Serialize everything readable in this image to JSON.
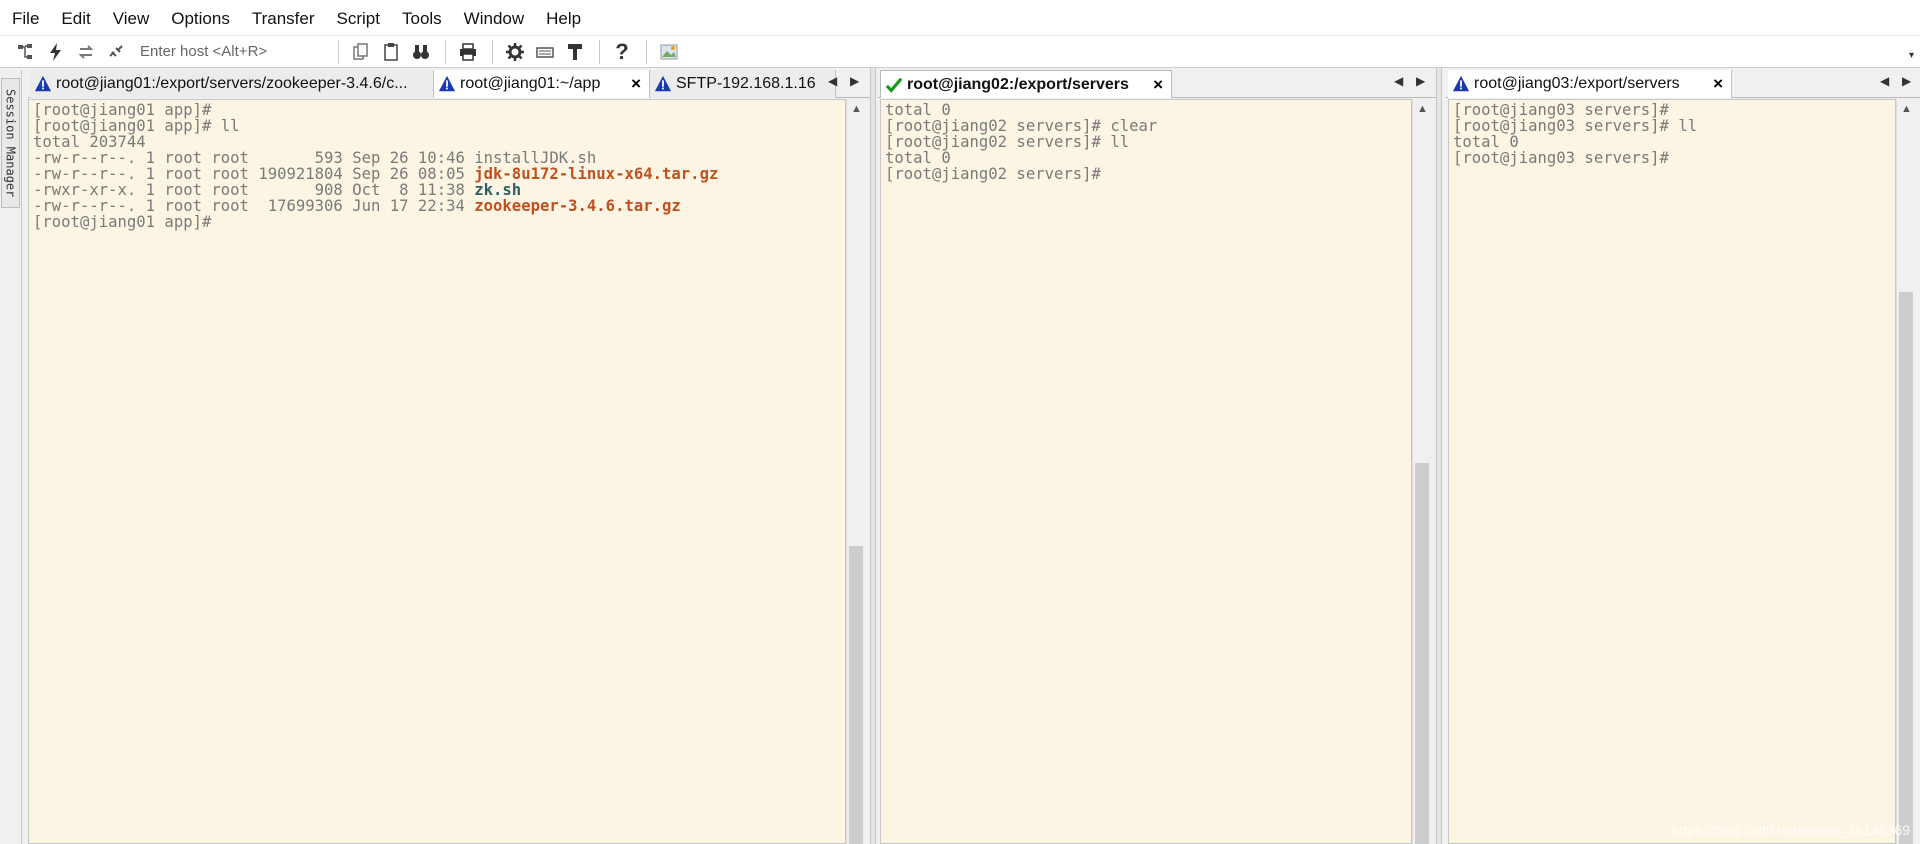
{
  "menu": [
    "File",
    "Edit",
    "View",
    "Options",
    "Transfer",
    "Script",
    "Tools",
    "Window",
    "Help"
  ],
  "toolbar": {
    "host_placeholder": "Enter host <Alt+R>"
  },
  "sidebar": {
    "session_manager_label": "Session Manager"
  },
  "pane1": {
    "tabs": [
      {
        "label": "root@jiang01:/export/servers/zookeeper-3.4.6/c...",
        "status": "warning"
      },
      {
        "label": "root@jiang01:~/app",
        "status": "warning",
        "close": "×"
      },
      {
        "label": "SFTP-192.168.1.16",
        "status": "warning"
      }
    ],
    "lines": [
      "[root@jiang01 app]#",
      "[root@jiang01 app]# ll",
      "total 203744"
    ],
    "files": [
      {
        "prefix": "-rw-r--r--. 1 root root       593 Sep 26 10:46 ",
        "name": "installJDK.sh",
        "style": "plain"
      },
      {
        "prefix": "-rw-r--r--. 1 root root 190921804 Sep 26 08:05 ",
        "name": "jdk-8u172-linux-x64.tar.gz",
        "style": "red"
      },
      {
        "prefix": "-rwxr-xr-x. 1 root root       908 Oct  8 11:38 ",
        "name": "zk.sh",
        "style": "teal"
      },
      {
        "prefix": "-rw-r--r--. 1 root root  17699306 Jun 17 22:34 ",
        "name": "zookeeper-3.4.6.tar.gz",
        "style": "red"
      }
    ],
    "last_line": "[root@jiang01 app]#"
  },
  "pane2": {
    "tab": {
      "label": "root@jiang02:/export/servers",
      "status": "ok",
      "close": "×"
    },
    "lines": [
      "total 0",
      "[root@jiang02 servers]# clear",
      "[root@jiang02 servers]# ll",
      "total 0",
      "[root@jiang02 servers]#"
    ]
  },
  "pane3": {
    "tab": {
      "label": "root@jiang03:/export/servers",
      "status": "warning",
      "close": "×"
    },
    "lines": [
      "[root@jiang03 servers]#",
      "[root@jiang03 servers]# ll",
      "total 0",
      "[root@jiang03 servers]#"
    ]
  },
  "watermark": "https://blog.csdn.net/weixin_36146369",
  "colors": {
    "terminal_bg": "#fcf5e3",
    "terminal_text": "#7a7a7a",
    "archive": "#c0501f",
    "executable": "#2e5f66"
  },
  "icons": [
    "session-tree-icon",
    "quick-connect-icon",
    "reconnect-icon",
    "disconnect-icon",
    "copy-icon",
    "paste-icon",
    "find-icon",
    "print-icon",
    "settings-icon",
    "keymap-icon",
    "sftp-icon",
    "help-icon",
    "image-icon",
    "warning-icon",
    "check-icon",
    "scroll-left-icon",
    "scroll-right-icon"
  ]
}
